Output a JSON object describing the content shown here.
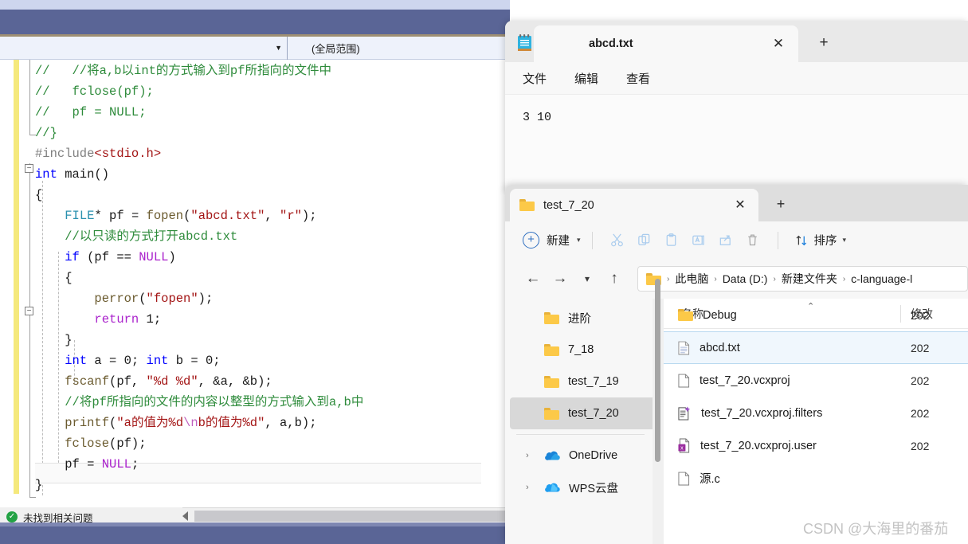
{
  "vs": {
    "nav": {
      "scope_combo_value": "",
      "global_scope_label": "(全局范围)"
    },
    "code_lines": [
      {
        "indent": 0,
        "tokens": [
          {
            "t": "//   //将a,b以int的方式输入到pf所指向的文件中",
            "c": "c-comment"
          }
        ]
      },
      {
        "indent": 0,
        "tokens": [
          {
            "t": "//   fclose(pf);",
            "c": "c-comment"
          }
        ]
      },
      {
        "indent": 0,
        "tokens": [
          {
            "t": "//   pf = NULL;",
            "c": "c-comment"
          }
        ]
      },
      {
        "indent": 0,
        "tokens": [
          {
            "t": "//}",
            "c": "c-comment"
          }
        ]
      },
      {
        "indent": 0,
        "tokens": [
          {
            "t": "#include",
            "c": "c-pre"
          },
          {
            "t": "<stdio.h>",
            "c": "c-inc"
          }
        ]
      },
      {
        "indent": 0,
        "tokens": [
          {
            "t": "int",
            "c": "c-kw"
          },
          {
            "t": " main()",
            "c": "c-plain"
          }
        ]
      },
      {
        "indent": 0,
        "tokens": [
          {
            "t": "{",
            "c": "c-plain"
          }
        ]
      },
      {
        "indent": 1,
        "tokens": [
          {
            "t": "FILE",
            "c": "c-type"
          },
          {
            "t": "* pf = ",
            "c": "c-plain"
          },
          {
            "t": "fopen",
            "c": "c-fn"
          },
          {
            "t": "(",
            "c": "c-plain"
          },
          {
            "t": "\"abcd.txt\"",
            "c": "c-str"
          },
          {
            "t": ", ",
            "c": "c-plain"
          },
          {
            "t": "\"r\"",
            "c": "c-str"
          },
          {
            "t": ");",
            "c": "c-plain"
          }
        ]
      },
      {
        "indent": 1,
        "tokens": [
          {
            "t": "//以只读的方式打开abcd.txt",
            "c": "c-comment"
          }
        ]
      },
      {
        "indent": 1,
        "tokens": [
          {
            "t": "if",
            "c": "c-kw"
          },
          {
            "t": " (pf == ",
            "c": "c-plain"
          },
          {
            "t": "NULL",
            "c": "c-kw2"
          },
          {
            "t": ")",
            "c": "c-plain"
          }
        ]
      },
      {
        "indent": 1,
        "tokens": [
          {
            "t": "{",
            "c": "c-plain"
          }
        ]
      },
      {
        "indent": 2,
        "tokens": [
          {
            "t": "perror",
            "c": "c-fn"
          },
          {
            "t": "(",
            "c": "c-plain"
          },
          {
            "t": "\"fopen\"",
            "c": "c-str"
          },
          {
            "t": ");",
            "c": "c-plain"
          }
        ]
      },
      {
        "indent": 2,
        "tokens": [
          {
            "t": "return",
            "c": "c-kw2"
          },
          {
            "t": " 1;",
            "c": "c-plain"
          }
        ]
      },
      {
        "indent": 1,
        "tokens": [
          {
            "t": "}",
            "c": "c-plain"
          }
        ]
      },
      {
        "indent": 1,
        "tokens": [
          {
            "t": "int",
            "c": "c-kw"
          },
          {
            "t": " a = 0; ",
            "c": "c-plain"
          },
          {
            "t": "int",
            "c": "c-kw"
          },
          {
            "t": " b = 0;",
            "c": "c-plain"
          }
        ]
      },
      {
        "indent": 1,
        "tokens": [
          {
            "t": "fscanf",
            "c": "c-fn"
          },
          {
            "t": "(pf, ",
            "c": "c-plain"
          },
          {
            "t": "\"%d %d\"",
            "c": "c-str"
          },
          {
            "t": ", &a, &b);",
            "c": "c-plain"
          }
        ]
      },
      {
        "indent": 1,
        "tokens": [
          {
            "t": "//将pf所指向的文件的内容以整型的方式输入到a,b中",
            "c": "c-comment"
          }
        ]
      },
      {
        "indent": 1,
        "tokens": [
          {
            "t": "printf",
            "c": "c-fn"
          },
          {
            "t": "(",
            "c": "c-plain"
          },
          {
            "t": "\"a的值为%d",
            "c": "c-str"
          },
          {
            "t": "\\n",
            "c": "c-esc"
          },
          {
            "t": "b的值为%d\"",
            "c": "c-str"
          },
          {
            "t": ", a,b);",
            "c": "c-plain"
          }
        ]
      },
      {
        "indent": 1,
        "tokens": [
          {
            "t": "fclose",
            "c": "c-fn"
          },
          {
            "t": "(pf);",
            "c": "c-plain"
          }
        ]
      },
      {
        "indent": 1,
        "tokens": [
          {
            "t": "pf = ",
            "c": "c-plain"
          },
          {
            "t": "NULL",
            "c": "c-kw2"
          },
          {
            "t": ";",
            "c": "c-plain"
          }
        ]
      },
      {
        "indent": 0,
        "tokens": [
          {
            "t": "}",
            "c": "c-plain"
          }
        ]
      }
    ],
    "highlighted_line_index": 16,
    "status": {
      "icon": "check-circle-icon",
      "text": "未找到相关问题"
    }
  },
  "notepad": {
    "app_icon": "notepad-icon",
    "tab_title": "abcd.txt",
    "close_label": "✕",
    "newtab_label": "+",
    "menus": [
      "文件",
      "编辑",
      "查看"
    ],
    "document_text": "3 10"
  },
  "explorer": {
    "tab_title": "test_7_20",
    "close_label": "✕",
    "newtab_label": "+",
    "toolbar": {
      "new_label": "新建",
      "new_chevron": "⌄",
      "icons": [
        "cut-icon",
        "copy-icon",
        "paste-icon",
        "rename-icon",
        "share-icon",
        "delete-icon"
      ],
      "sort_label": "排序",
      "sort_chevron": "⌄"
    },
    "address": {
      "back": "←",
      "forward": "→",
      "recent": "⌄",
      "up": "↑",
      "crumbs": [
        "此电脑",
        "Data (D:)",
        "新建文件夹",
        "c-language-l"
      ],
      "separator": "›"
    },
    "navpane": [
      {
        "label": "进阶",
        "icon": "folder-icon",
        "expandable": false,
        "selected": false
      },
      {
        "label": "7_18",
        "icon": "folder-icon",
        "expandable": false,
        "selected": false
      },
      {
        "label": "test_7_19",
        "icon": "folder-icon",
        "expandable": false,
        "selected": false
      },
      {
        "label": "test_7_20",
        "icon": "folder-icon",
        "expandable": false,
        "selected": true
      },
      {
        "label": "OneDrive",
        "icon": "onedrive-icon",
        "expandable": true,
        "selected": false
      },
      {
        "label": "WPS云盘",
        "icon": "wps-cloud-icon",
        "expandable": true,
        "selected": false
      }
    ],
    "columns": {
      "name": "名称",
      "date": "修改"
    },
    "sort_caret": "⌃",
    "files": [
      {
        "name": "Debug",
        "icon": "folder-icon",
        "date": "202",
        "selected": false
      },
      {
        "name": "abcd.txt",
        "icon": "text-file-icon",
        "date": "202",
        "selected": true
      },
      {
        "name": "test_7_20.vcxproj",
        "icon": "file-icon",
        "date": "202",
        "selected": false
      },
      {
        "name": "test_7_20.vcxproj.filters",
        "icon": "filters-file-icon",
        "date": "202",
        "selected": false
      },
      {
        "name": "test_7_20.vcxproj.user",
        "icon": "user-file-icon",
        "date": "202",
        "selected": false
      },
      {
        "name": "源.c",
        "icon": "file-icon",
        "date": "",
        "selected": false
      }
    ]
  },
  "watermark": "CSDN @大海里的番茄",
  "colors": {
    "vs_titlebar": "#5a6596",
    "vs_topstrip": "#cdd6ee",
    "accent_blue": "#2f6fc0",
    "folder_yellow": "#fcc948",
    "status_green": "#22a244",
    "change_bar_yellow": "#f5e97c"
  }
}
